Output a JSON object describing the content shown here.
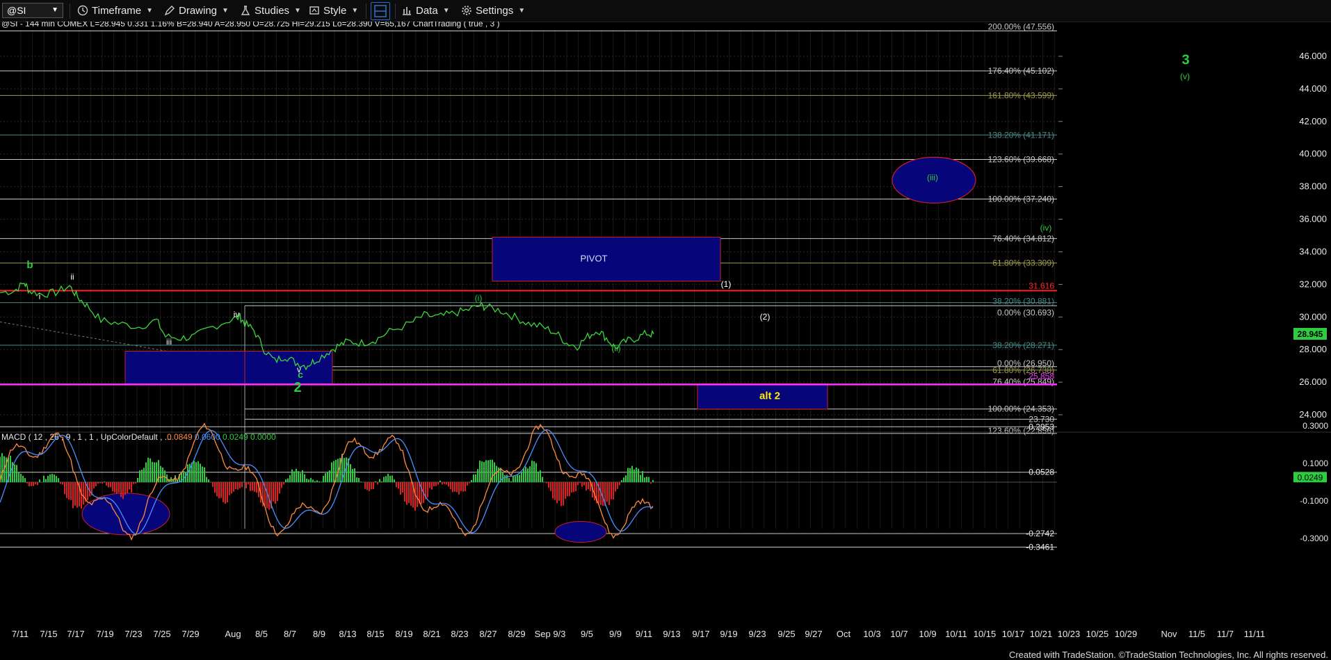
{
  "toolbar": {
    "symbol": "@SI",
    "timeframe": "Timeframe",
    "drawing": "Drawing",
    "studies": "Studies",
    "style": "Style",
    "data": "Data",
    "settings": "Settings"
  },
  "header": {
    "text": "@SI - 144 min  COMEX  L=28.945  0.331  1.16%  B=28.940  A=28.950  O=28.725  Hi=29.215  Lo=28.390  V=65,167  ChartTrading ( true , 3 )"
  },
  "price_axis": {
    "labels": [
      "46.000",
      "44.000",
      "42.000",
      "40.000",
      "38.000",
      "36.000",
      "34.000",
      "32.000",
      "30.000",
      "28.000",
      "26.000",
      "24.000"
    ],
    "last_price": "28.945"
  },
  "fib_levels": [
    {
      "label": "200.00% (47.556)",
      "value": 47.556,
      "color": "#c8c8c8"
    },
    {
      "label": "176.40% (45.102)",
      "value": 45.102,
      "color": "#c8c8c8"
    },
    {
      "label": "161.80% (43.599)",
      "value": 43.599,
      "color": "#9a9a50"
    },
    {
      "label": "138.20% (41.171)",
      "value": 41.171,
      "color": "#4a8a8a"
    },
    {
      "label": "123.60% (39.668)",
      "value": 39.668,
      "color": "#c8c8c8"
    },
    {
      "label": "100.00% (37.240)",
      "value": 37.24,
      "color": "#c8c8c8"
    },
    {
      "label": "76.40% (34.812)",
      "value": 34.812,
      "color": "#c8c8c8"
    },
    {
      "label": "61.80% (33.309)",
      "value": 33.309,
      "color": "#9a9a50"
    },
    {
      "label": "31.616",
      "value": 31.616,
      "color": "#ff2020"
    },
    {
      "label": "38.20% (30.881)",
      "value": 30.881,
      "color": "#4a8a8a"
    },
    {
      "label": "0.00% (30.693)",
      "value": 30.693,
      "color": "#c8c8c8"
    },
    {
      "label": "38.20% (28.271)",
      "value": 28.271,
      "color": "#4a8a8a"
    },
    {
      "label": "0.00% (26.950)",
      "value": 26.95,
      "color": "#c8c8c8"
    },
    {
      "label": "61.80% (26.738)",
      "value": 26.738,
      "color": "#9a9a50"
    },
    {
      "label": "76.40% (25.849)",
      "value": 25.849,
      "color": "#c8c8c8"
    },
    {
      "label": "25.858",
      "value": 25.858,
      "color": "#ff30ff"
    },
    {
      "label": "100.00% (24.353)",
      "value": 24.353,
      "color": "#c8c8c8"
    },
    {
      "label": "23.730",
      "value": 23.73,
      "color": "#c8c8c8"
    },
    {
      "label": "123.60% (22.856)",
      "value": 22.856,
      "color": "#c8c8c8"
    }
  ],
  "wave_labels": [
    {
      "text": "b",
      "color": "#2ecc40",
      "bold": true
    },
    {
      "text": "ii",
      "color": "#ffffff",
      "bold": false
    },
    {
      "text": "i",
      "color": "#ffffff",
      "bold": false
    },
    {
      "text": "iii",
      "color": "#ffffff",
      "bold": false
    },
    {
      "text": "iv",
      "color": "#ffffff",
      "bold": false
    },
    {
      "text": "v",
      "color": "#ffffff",
      "bold": false
    },
    {
      "text": "c",
      "color": "#2ecc40",
      "bold": true
    },
    {
      "text": "2",
      "color": "#2ecc40",
      "bold": true
    },
    {
      "text": "(i)",
      "color": "#2ecc40",
      "bold": false
    },
    {
      "text": "(ii)",
      "color": "#2ecc40",
      "bold": false
    },
    {
      "text": "(1)",
      "color": "#ffffff",
      "bold": false
    },
    {
      "text": "(2)",
      "color": "#ffffff",
      "bold": false
    },
    {
      "text": "(iii)",
      "color": "#2ecc40",
      "bold": false
    },
    {
      "text": "(iv)",
      "color": "#2ecc40",
      "bold": false
    },
    {
      "text": "(v)",
      "color": "#2ecc40",
      "bold": false
    },
    {
      "text": "3",
      "color": "#2ecc40",
      "bold": true
    }
  ],
  "boxes": {
    "pivot": "PIVOT",
    "alt2": "alt 2"
  },
  "macd": {
    "header": "MACD ( 12 , 26 , 9 , 1 , 1 , UpColorDefault , ...",
    "values": [
      "0.0849",
      "0.0600",
      "0.0249",
      "0.0000"
    ],
    "value_colors": [
      "#ff8c42",
      "#4a90ff",
      "#2ecc40",
      "#2ecc40"
    ],
    "axis_labels": [
      "0.3000",
      "0.1000",
      "-0.1000",
      "-0.3000"
    ],
    "level_labels": [
      "0.2953",
      "0.0528",
      "-0.2742",
      "-0.3461"
    ],
    "last_value": "0.0249"
  },
  "x_axis": {
    "labels": [
      "7/11",
      "7/15",
      "7/17",
      "7/19",
      "7/23",
      "7/25",
      "7/29",
      "Aug",
      "8/5",
      "8/7",
      "8/9",
      "8/13",
      "8/15",
      "8/19",
      "8/21",
      "8/23",
      "8/27",
      "8/29",
      "Sep 9/3",
      "9/5",
      "9/9",
      "9/11",
      "9/13",
      "9/17",
      "9/19",
      "9/23",
      "9/25",
      "9/27",
      "Oct",
      "10/3",
      "10/7",
      "10/9",
      "10/11",
      "10/15",
      "10/17",
      "10/21",
      "10/23",
      "10/25",
      "10/29",
      "Nov",
      "11/5",
      "11/7",
      "11/11"
    ]
  },
  "footer": "Created with TradeStation. ©TradeStation Technologies, Inc. All rights reserved."
}
